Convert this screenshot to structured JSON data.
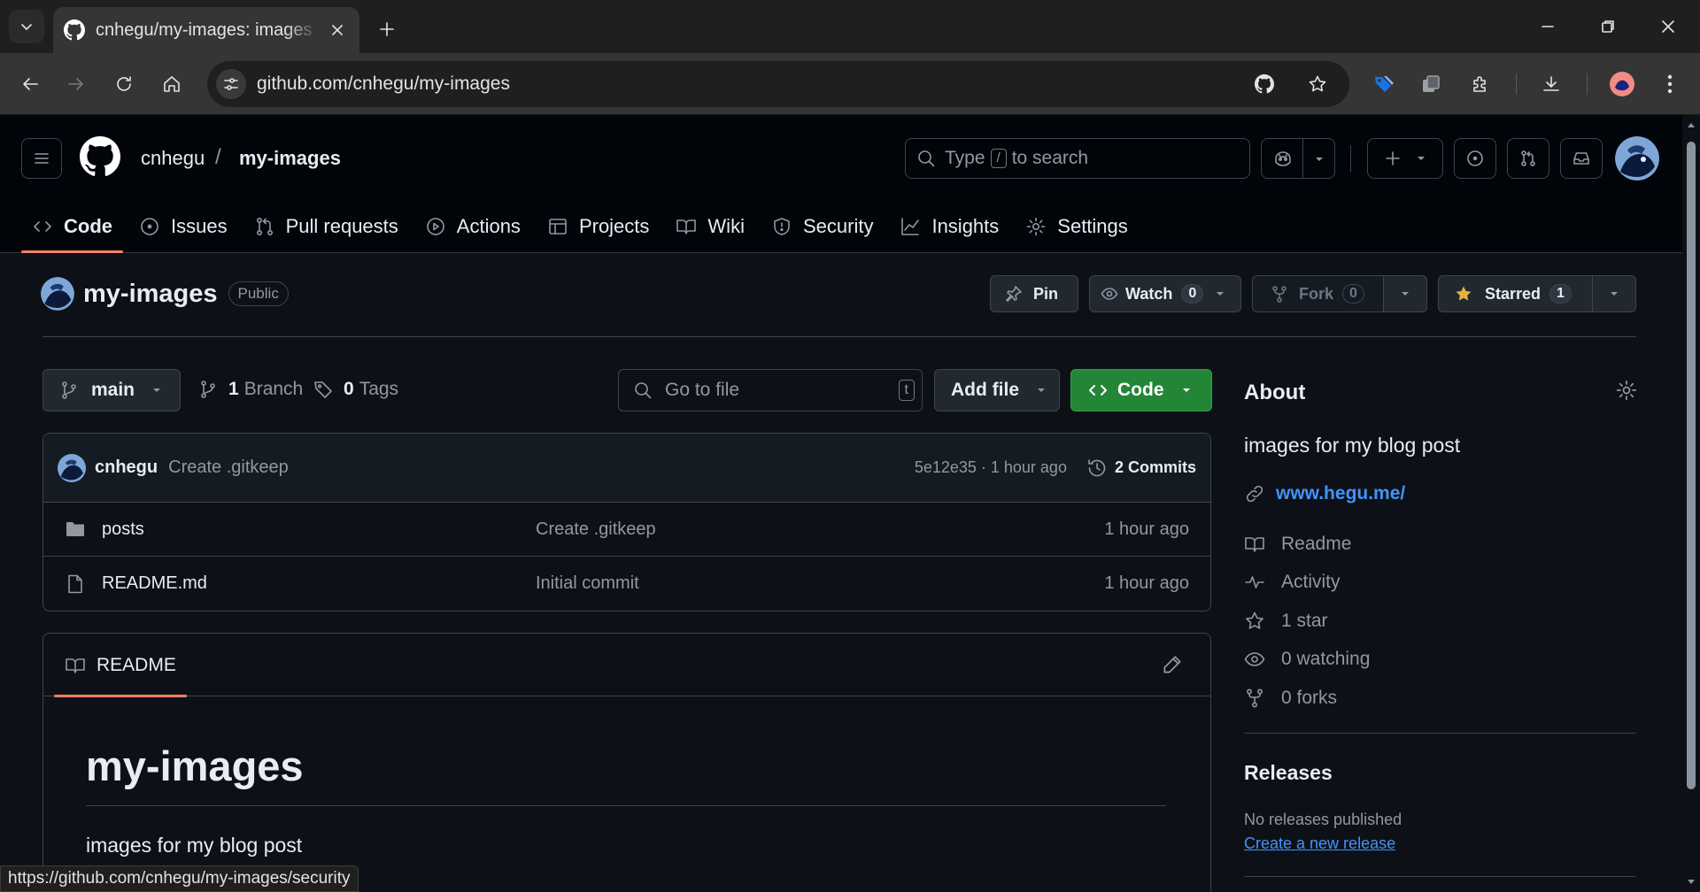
{
  "browser": {
    "tab_title": "cnhegu/my-images: images for my blog post",
    "url": "github.com/cnhegu/my-images",
    "status_url": "https://github.com/cnhegu/my-images/security"
  },
  "header": {
    "owner": "cnhegu",
    "separator": "/",
    "repo": "my-images",
    "search_prefix": "Type",
    "search_key": "/",
    "search_suffix": "to search"
  },
  "nav": {
    "code": "Code",
    "issues": "Issues",
    "pulls": "Pull requests",
    "actions": "Actions",
    "projects": "Projects",
    "wiki": "Wiki",
    "security": "Security",
    "insights": "Insights",
    "settings": "Settings"
  },
  "repo": {
    "name": "my-images",
    "visibility": "Public",
    "pin": "Pin",
    "watch": "Watch",
    "watch_count": "0",
    "fork": "Fork",
    "fork_count": "0",
    "starred": "Starred",
    "star_count": "1"
  },
  "filebar": {
    "branch": "main",
    "branch_count": "1",
    "branch_label": "Branch",
    "tag_count": "0",
    "tag_label": "Tags",
    "goto_placeholder": "Go to file",
    "goto_key": "t",
    "add_file": "Add file",
    "code": "Code"
  },
  "commit": {
    "user": "cnhegu",
    "message": "Create .gitkeep",
    "meta": "5e12e35 · 1 hour ago",
    "commits": "2 Commits"
  },
  "files": [
    {
      "name": "posts",
      "message": "Create .gitkeep",
      "time": "1 hour ago",
      "type": "folder"
    },
    {
      "name": "README.md",
      "message": "Initial commit",
      "time": "1 hour ago",
      "type": "file"
    }
  ],
  "readme": {
    "tab": "README",
    "heading": "my-images",
    "body": "images for my blog post"
  },
  "about": {
    "title": "About",
    "description": "images for my blog post",
    "website": "www.hegu.me/",
    "readme": "Readme",
    "activity": "Activity",
    "stars": "1 star",
    "watching": "0 watching",
    "forks": "0 forks"
  },
  "releases": {
    "title": "Releases",
    "none": "No releases published",
    "create": "Create a new release"
  },
  "colors": {
    "accent_underline": "#f78166",
    "code_button": "#238636",
    "link": "#4493f8",
    "star": "#e3b341"
  }
}
